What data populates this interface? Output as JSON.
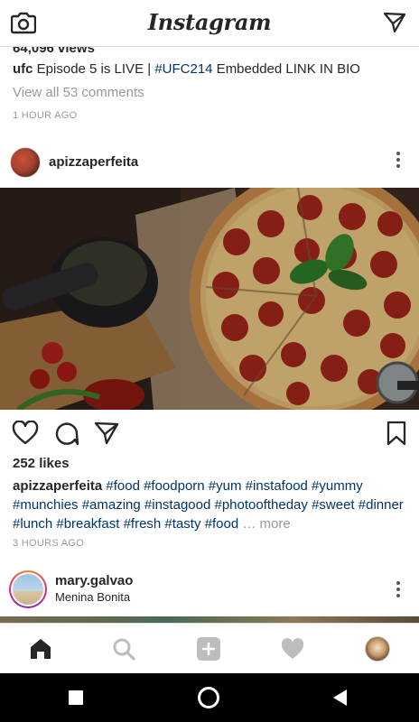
{
  "app": {
    "title": "Instagram"
  },
  "previous_post": {
    "views": "64,096 views",
    "caption_user": "ufc",
    "caption_text": " Episode 5 is LIVE | ",
    "caption_tag": "#UFC214",
    "caption_rest": " Embedded LINK IN BIO",
    "view_all": "View all 53 comments",
    "timestamp": "1 HOUR AGO"
  },
  "post": {
    "username": "apizzaperfeita",
    "likes": "252 likes",
    "caption_user": "apizzaperfeita",
    "hashtags_line": "#food #foodporn #yum #instafood #yummy #munchies #amazing #instagood #photooftheday #sweet #dinner #lunch #breakfast #fresh #tasty #food",
    "more": " … more",
    "timestamp": "3 HOURS AGO"
  },
  "next_post": {
    "username": "mary.galvao",
    "location": "Menina Bonita"
  },
  "icons": {
    "camera": "camera-icon",
    "direct": "direct-message-icon",
    "like": "heart-icon",
    "comment": "comment-icon",
    "share": "share-icon",
    "save": "bookmark-icon",
    "more": "more-options-icon",
    "home": "home-icon",
    "search": "search-icon",
    "add": "add-post-icon",
    "activity": "activity-heart-icon",
    "profile": "profile-avatar"
  },
  "colors": {
    "hashtag": "#003569",
    "muted": "#999999",
    "text": "#262626"
  }
}
